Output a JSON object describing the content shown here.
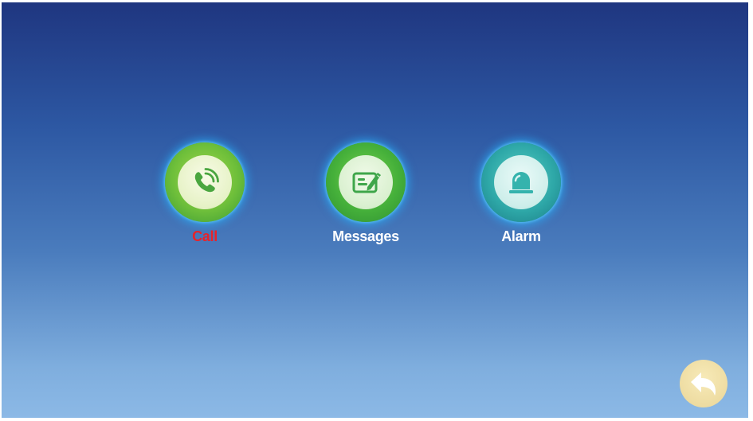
{
  "menu": {
    "items": [
      {
        "label": "Call",
        "icon": "phone-icon",
        "label_color": "#e8232a",
        "selected": true
      },
      {
        "label": "Messages",
        "icon": "message-edit-icon",
        "label_color": "#ffffff",
        "selected": false
      },
      {
        "label": "Alarm",
        "icon": "alarm-siren-icon",
        "label_color": "#ffffff",
        "selected": false
      }
    ]
  },
  "back_button": {
    "icon": "back-arrow-icon"
  },
  "colors": {
    "background_top": "#1f3680",
    "background_bottom": "#8cb9e6",
    "selected_label": "#e8232a",
    "icon_green": "#45b03a",
    "icon_teal": "#2ea8a8",
    "back_button": "#ead698"
  }
}
